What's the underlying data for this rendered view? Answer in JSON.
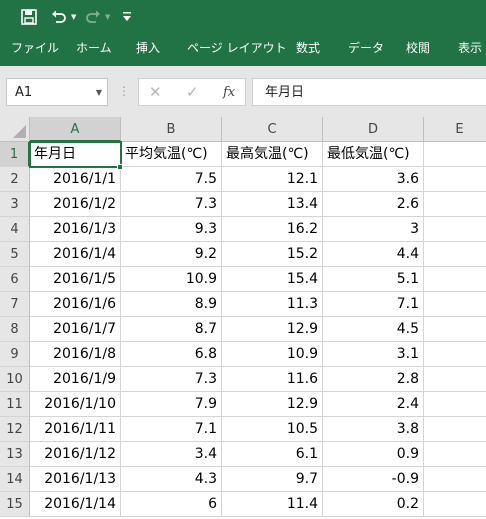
{
  "quick_access": {
    "save_icon": "save-icon",
    "undo_icon": "undo-icon",
    "redo_icon": "redo-icon",
    "customize_icon": "customize-qat-icon"
  },
  "ribbon": {
    "tabs": [
      "ファイル",
      "ホーム",
      "挿入",
      "ページ レイアウト",
      "数式",
      "データ",
      "校閲",
      "表示"
    ]
  },
  "formula_bar": {
    "name_box": "A1",
    "cancel_icon": "✕",
    "enter_icon": "✓",
    "fx_label": "fx",
    "content": "年月日"
  },
  "sheet": {
    "columns": [
      "A",
      "B",
      "C",
      "D",
      "E"
    ],
    "row_numbers": [
      "1",
      "2",
      "3",
      "4",
      "5",
      "6",
      "7",
      "8",
      "9",
      "10",
      "11",
      "12",
      "13",
      "14",
      "15"
    ],
    "header": [
      "年月日",
      "平均気温(℃)",
      "最高気温(℃)",
      "最低気温(℃)"
    ],
    "rows": [
      [
        "2016/1/1",
        "7.5",
        "12.1",
        "3.6"
      ],
      [
        "2016/1/2",
        "7.3",
        "13.4",
        "2.6"
      ],
      [
        "2016/1/3",
        "9.3",
        "16.2",
        "3"
      ],
      [
        "2016/1/4",
        "9.2",
        "15.2",
        "4.4"
      ],
      [
        "2016/1/5",
        "10.9",
        "15.4",
        "5.1"
      ],
      [
        "2016/1/6",
        "8.9",
        "11.3",
        "7.1"
      ],
      [
        "2016/1/7",
        "8.7",
        "12.9",
        "4.5"
      ],
      [
        "2016/1/8",
        "6.8",
        "10.9",
        "3.1"
      ],
      [
        "2016/1/9",
        "7.3",
        "11.6",
        "2.8"
      ],
      [
        "2016/1/10",
        "7.9",
        "12.9",
        "2.4"
      ],
      [
        "2016/1/11",
        "7.1",
        "10.5",
        "3.8"
      ],
      [
        "2016/1/12",
        "3.4",
        "6.1",
        "0.9"
      ],
      [
        "2016/1/13",
        "4.3",
        "9.7",
        "-0.9"
      ],
      [
        "2016/1/14",
        "6",
        "11.4",
        "0.2"
      ]
    ]
  },
  "colors": {
    "accent": "#217346",
    "header_bg": "#e6e6e6",
    "gridline": "#d4d4d4"
  }
}
